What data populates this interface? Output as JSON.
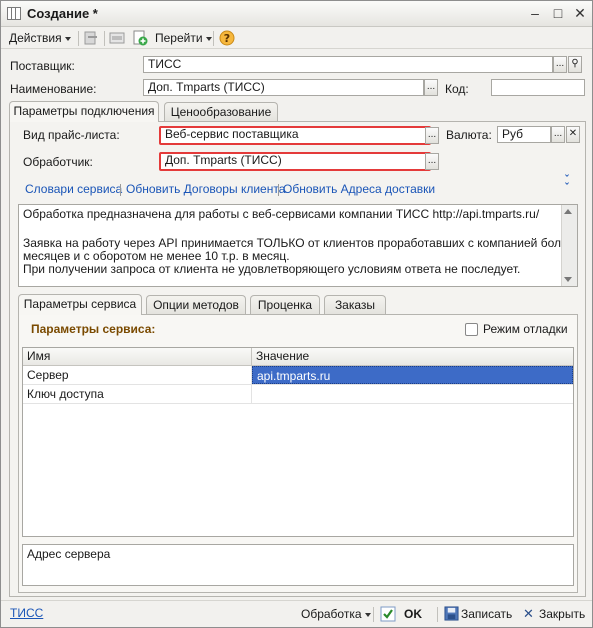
{
  "window": {
    "title": "Создание *"
  },
  "toolbar": {
    "actions_label": "Действия",
    "goto_label": "Перейти"
  },
  "header": {
    "supplier_label": "Поставщик:",
    "supplier_value": "ТИСС",
    "name_label": "Наименование:",
    "name_value": "Доп. Tmparts (ТИСС)",
    "code_label": "Код:",
    "code_value": ""
  },
  "tabs": [
    {
      "label": "Параметры подключения",
      "active": true
    },
    {
      "label": "Ценообразование",
      "active": false
    }
  ],
  "connection": {
    "pricelist_type_label": "Вид прайс-листа:",
    "pricelist_type_value": "Веб-сервис поставщика",
    "currency_label": "Валюта:",
    "currency_value": "Руб",
    "handler_label": "Обработчик:",
    "handler_value": "Доп. Tmparts (ТИСС)",
    "links": [
      "Словари сервиса",
      "Обновить Договоры клиента",
      "Обновить Адреса доставки"
    ],
    "description": [
      "Обработка предназначена для работы с веб-сервисами компании ТИСС http://api.tmparts.ru/",
      "",
      "Заявка на работу через API принимается ТОЛЬКО от клиентов проработавших с компанией более 2-х",
      "месяцев и с оборотом не менее 10 т.р. в месяц.",
      "При получении запроса от клиента не удовлетворяющего условиям ответа не последует."
    ]
  },
  "inner_tabs": [
    {
      "label": "Параметры сервиса",
      "active": true
    },
    {
      "label": "Опции методов",
      "active": false
    },
    {
      "label": "Проценка",
      "active": false
    },
    {
      "label": "Заказы",
      "active": false
    }
  ],
  "service_params": {
    "section_title": "Параметры сервиса:",
    "debug_mode_label": "Режим отладки",
    "debug_mode_checked": false,
    "columns": [
      "Имя",
      "Значение"
    ],
    "rows": [
      {
        "name": "Сервер",
        "value": "api.tmparts.ru",
        "selected": true
      },
      {
        "name": "Ключ доступа",
        "value": "",
        "selected": false
      }
    ],
    "hint": "Адрес сервера"
  },
  "footer": {
    "link": "ТИСС",
    "processing_label": "Обработка",
    "ok_label": "OK",
    "save_label": "Записать",
    "close_label": "Закрыть"
  },
  "colors": {
    "highlight_border": "#e43a3a",
    "link": "#1a55b7",
    "selection": "#3d6bc7",
    "section_title": "#7a4a00"
  }
}
